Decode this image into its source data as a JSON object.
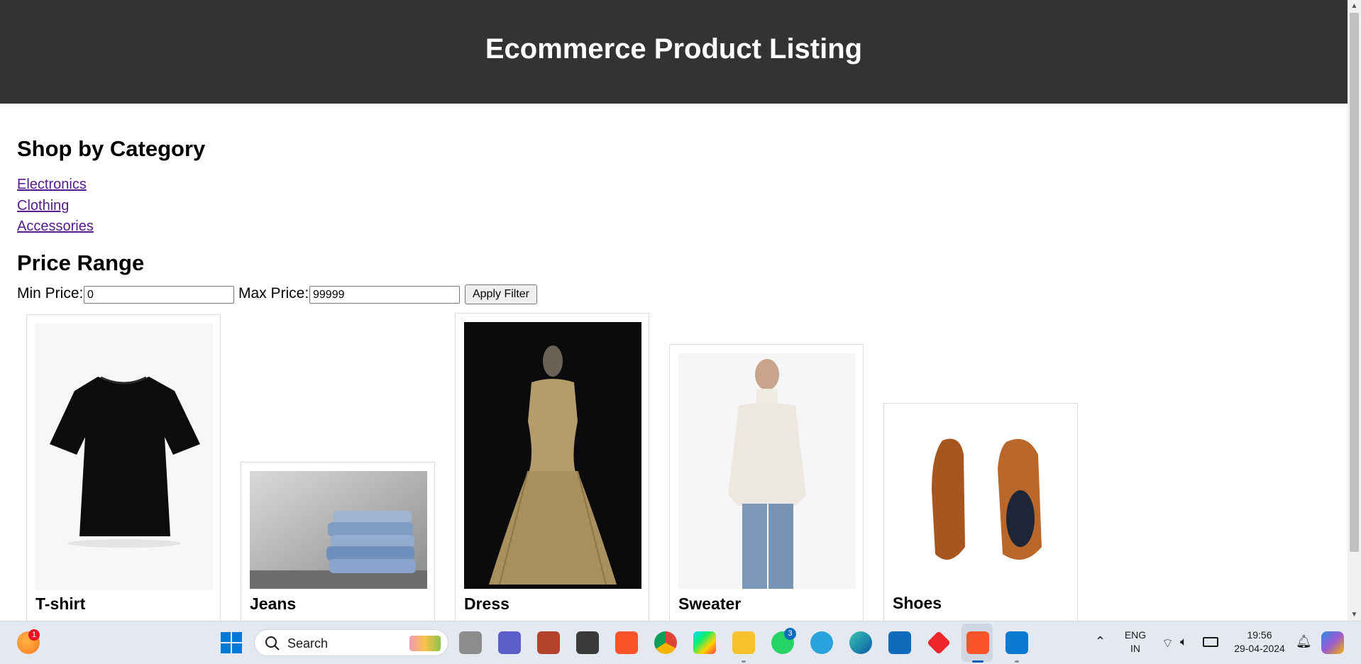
{
  "header": {
    "title": "Ecommerce Product Listing"
  },
  "categories": {
    "heading": "Shop by Category",
    "items": [
      "Electronics",
      "Clothing",
      "Accessories"
    ]
  },
  "price_range": {
    "heading": "Price Range",
    "min_label": "Min Price:",
    "min_value": "0",
    "max_label": "Max Price:",
    "max_value": "99999",
    "apply_label": "Apply Filter"
  },
  "products": [
    {
      "name": "T-shirt",
      "image": "black t-shirt"
    },
    {
      "name": "Jeans",
      "image": "stack of jeans"
    },
    {
      "name": "Dress",
      "image": "lace dress on mannequin"
    },
    {
      "name": "Sweater",
      "image": "man in white sweater"
    },
    {
      "name": "Shoes",
      "image": "brown brogue shoes"
    }
  ],
  "taskbar": {
    "search_placeholder": "Search",
    "weather_badge": "1",
    "whatsapp_badge": "3",
    "language_line1": "ENG",
    "language_line2": "IN",
    "time": "19:56",
    "date": "29-04-2024",
    "accent_color": "#005fb8"
  }
}
